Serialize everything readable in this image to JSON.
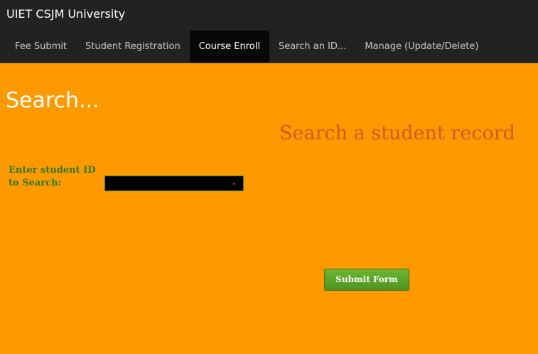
{
  "header": {
    "brand": "UIET CSJM University"
  },
  "nav": {
    "items": [
      {
        "label": "Fee Submit",
        "active": false
      },
      {
        "label": "Student Registration",
        "active": false
      },
      {
        "label": "Course Enroll",
        "active": true
      },
      {
        "label": "Search an ID...",
        "active": false
      },
      {
        "label": "Manage (Update/Delete)",
        "active": false
      }
    ]
  },
  "main": {
    "heading": "Search...",
    "title": "Search a student record",
    "form": {
      "id_label": "Enter student ID to Search:",
      "id_value": "",
      "id_placeholder": "",
      "submit_label": "Submit Form"
    }
  },
  "colors": {
    "page_background": "#ff9900",
    "header_background": "#222222",
    "active_tab_background": "#080808",
    "title_color": "#d35a1e",
    "label_color": "#2a7a12",
    "button_green": "#5aa428",
    "required_marker": "#d81818"
  }
}
